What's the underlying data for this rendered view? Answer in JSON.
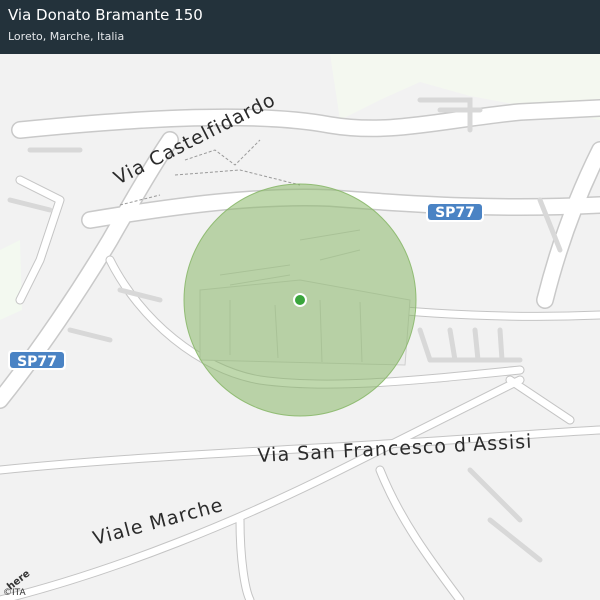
{
  "header": {
    "title": "Via Donato Bramante 150",
    "subtitle": "Loreto, Marche, Italia"
  },
  "map": {
    "roads": {
      "castelfidardo": "Via Castelfidardo",
      "san_francesco": "Via San Francesco d'Assisi",
      "viale_marche": "Viale Marche"
    },
    "shields": {
      "sp77_right": "SP77",
      "sp77_left": "SP77"
    },
    "accuracy_circle_color": "#8ab86a",
    "location_dot_color": "#3aa53c",
    "shield_color": "#4a83c4"
  },
  "attribution": {
    "brand": "here",
    "copyright": "©ITA"
  }
}
